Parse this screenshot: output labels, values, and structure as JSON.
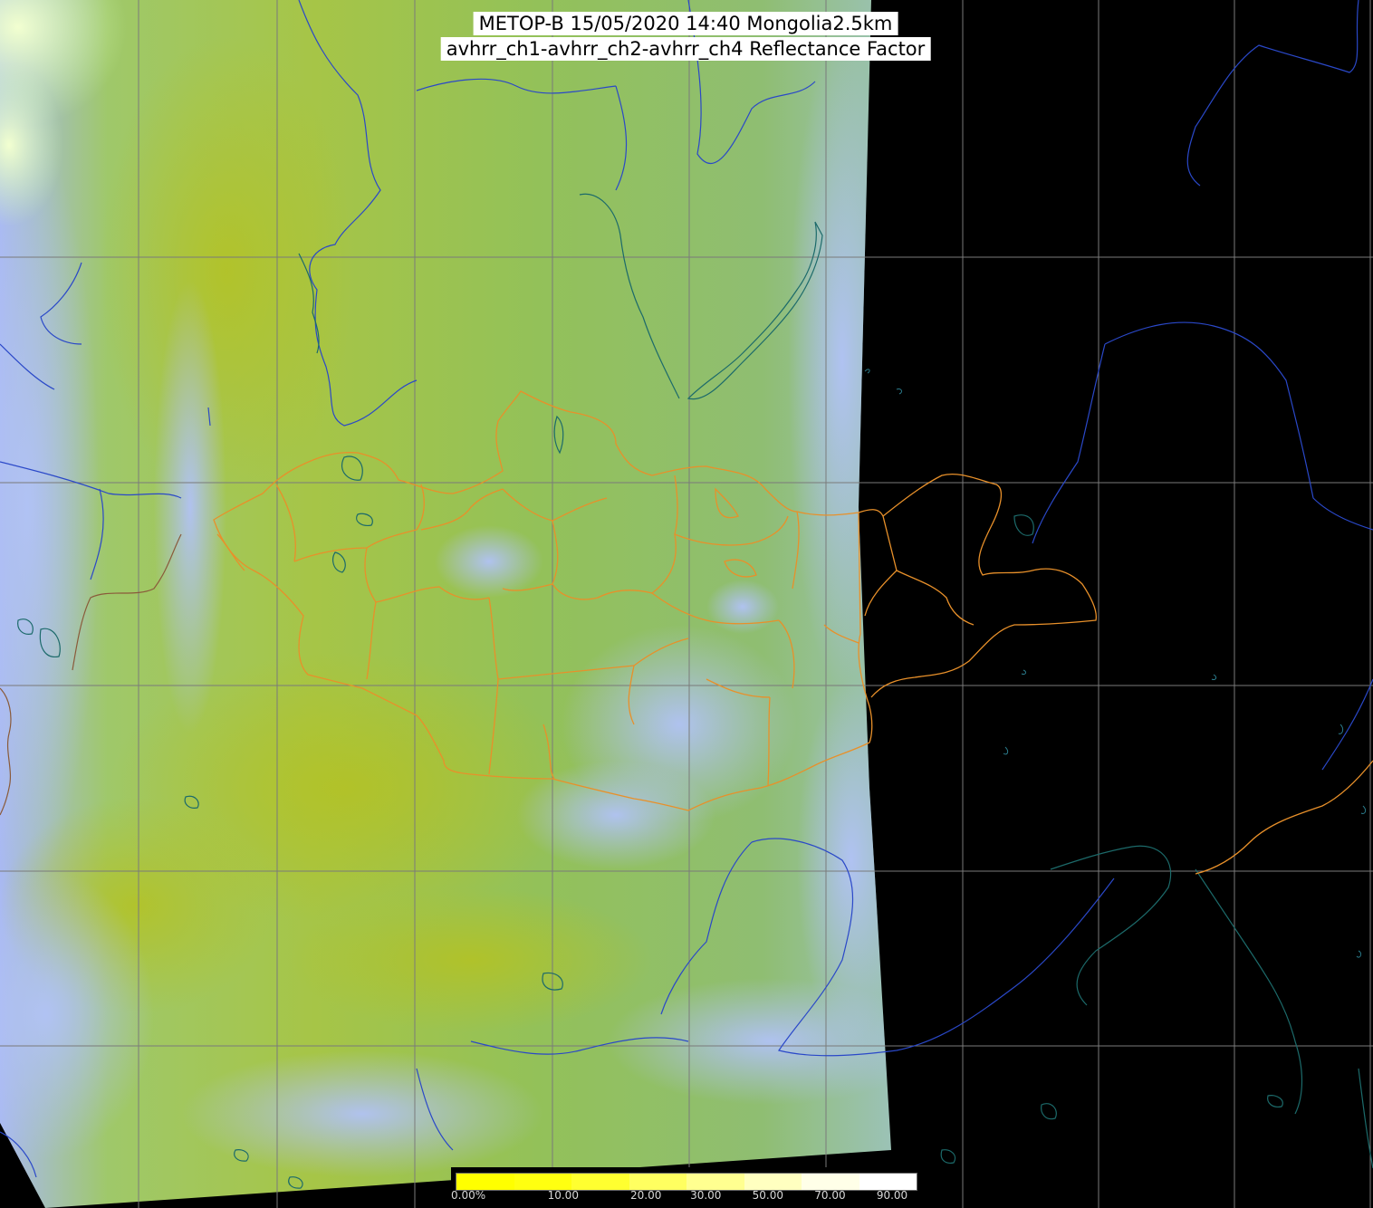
{
  "title": {
    "line1": "METOP-B 15/05/2020 14:40 Mongolia2.5km",
    "line2": "avhrr_ch1-avhrr_ch2-avhrr_ch4 Reflectance Factor"
  },
  "colors": {
    "background": "#000000",
    "grid": "#7a7a7a",
    "rivers_coast": "#2a48c8",
    "coast_dark": "#1c6a6a",
    "borders": "#e8902a",
    "country_border": "#8a5a3a",
    "imagery_green": "#8fbf5a",
    "imagery_yellow": "#b5c23a",
    "imagery_cloud": "#a8b8f0"
  },
  "legend": {
    "labels": [
      "0.00%",
      "10.00",
      "20.00",
      "30.00",
      "50.00",
      "70.00",
      "90.00"
    ],
    "stops": [
      0.0,
      0.2,
      0.38,
      0.51,
      0.645,
      0.78,
      0.915
    ],
    "colors": [
      "#ffff00",
      "#ffff10",
      "#ffff30",
      "#ffff60",
      "#ffff90",
      "#ffffc0",
      "#ffffe8",
      "#ffffff"
    ]
  }
}
